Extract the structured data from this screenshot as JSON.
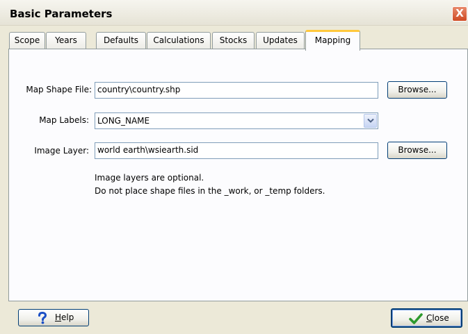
{
  "window": {
    "title": "Basic Parameters",
    "close_glyph": "X"
  },
  "tabs": [
    {
      "label": "Scope",
      "active": false
    },
    {
      "label": "Years",
      "active": false
    },
    {
      "label": "Defaults",
      "active": false
    },
    {
      "label": "Calculations",
      "active": false
    },
    {
      "label": "Stocks",
      "active": false
    },
    {
      "label": "Updates",
      "active": false
    },
    {
      "label": "Mapping",
      "active": true
    }
  ],
  "mapping": {
    "shape_file": {
      "label": "Map Shape File:",
      "value": "country\\country.shp",
      "browse_label": "Browse..."
    },
    "labels": {
      "label": "Map Labels:",
      "value": "LONG_NAME"
    },
    "image_layer": {
      "label": "Image Layer:",
      "value": "world earth\\wsiearth.sid",
      "browse_label": "Browse..."
    },
    "notes": [
      "Image layers are optional.",
      "Do not place shape files in the _work, or _temp folders."
    ]
  },
  "footer": {
    "help": {
      "label_mnemonic": "H",
      "label_rest": "elp",
      "icon": "question-icon"
    },
    "close": {
      "label_mnemonic": "C",
      "label_rest": "lose",
      "icon": "checkmark-icon"
    }
  },
  "colors": {
    "accent_tab": "#ffc83c",
    "help_icon": "#1b4fc6",
    "check_icon": "#2d9a2d"
  }
}
